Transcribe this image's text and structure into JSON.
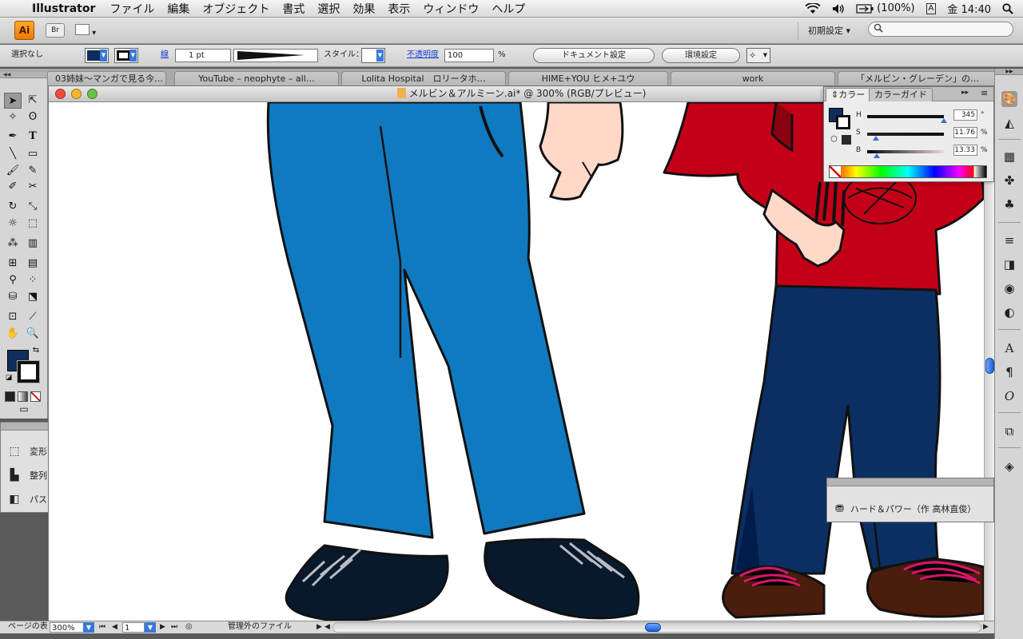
{
  "menubar": {
    "apple": "",
    "app_name": "Illustrator",
    "menus": [
      "ファイル",
      "編集",
      "オブジェクト",
      "書式",
      "選択",
      "効果",
      "表示",
      "ウィンドウ",
      "ヘルプ"
    ],
    "battery": "(100%)",
    "input_mode": "A",
    "clock": "金 14:40"
  },
  "appbar": {
    "logo": "Ai",
    "bridge": "Br",
    "workspace": "初期設定 ▾"
  },
  "controlbar": {
    "selection": "選択なし",
    "stroke_label": "線",
    "stroke_weight": "1 pt",
    "style_label": "スタイル：",
    "opacity_label": "不透明度",
    "opacity_value": "100",
    "opacity_unit": "%",
    "document_setup": "ドキュメント設定",
    "preferences": "環境設定",
    "fill_color": "#102e5c"
  },
  "tabs": [
    "03姉妹〜マンガで見る今…",
    "YouTube – neophyte – all…",
    "Lolita Hospital　ロリータホ…",
    "HIME+YOU ヒメ+ユウ",
    "work",
    "「メルビン・グレーデン」の…"
  ],
  "document": {
    "title": "メルビン＆アルミーン.ai* @ 300% (RGB/プレビュー)"
  },
  "left_panel": {
    "items": [
      "変形",
      "整列",
      "パスファインダ"
    ]
  },
  "color_panel": {
    "tab_color": "カラー",
    "tab_guide": "カラーガイド",
    "h_label": "H",
    "h_value": "345",
    "h_unit": "°",
    "s_label": "S",
    "s_value": "11.76",
    "s_unit": "%",
    "b_label": "B",
    "b_value": "13.33",
    "b_unit": "%"
  },
  "hard_panel": {
    "label": "ハード＆パワー（作 高林直俊）"
  },
  "status": {
    "zoom": "300%",
    "page": "1",
    "info": "管理外のファイル",
    "hint": "ページの表"
  },
  "colors": {
    "jeans_light": "#0f7ac0",
    "jeans_dark": "#0b2f63",
    "shirt_red": "#c40018",
    "shoe_navy": "#08192c",
    "shoe_brown": "#4a1d0c",
    "lace_pink": "#d8156e",
    "skin": "#ffd8c8"
  }
}
